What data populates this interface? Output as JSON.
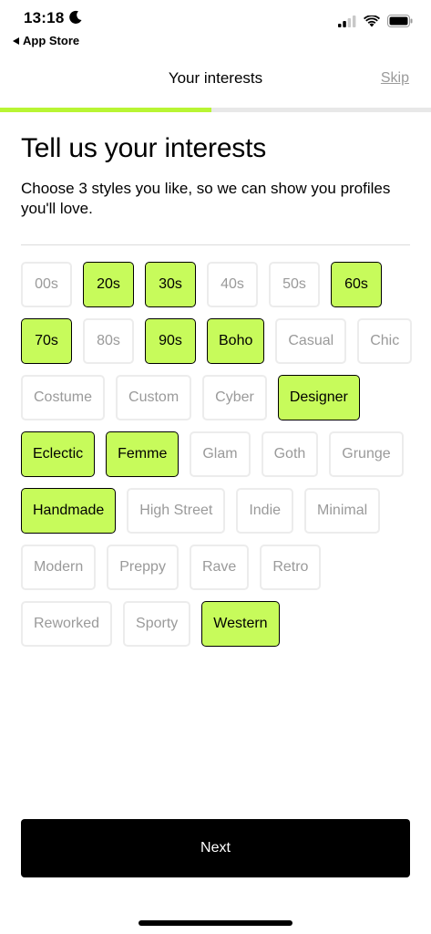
{
  "status_bar": {
    "time": "13:18",
    "back_app": "App Store",
    "icons": [
      "moon-icon",
      "cellular-signal-icon",
      "wifi-icon",
      "battery-icon"
    ]
  },
  "nav": {
    "title": "Your interests",
    "skip_label": "Skip"
  },
  "progress": {
    "fraction": 0.49
  },
  "content": {
    "heading": "Tell us your interests",
    "subheading": "Choose 3 styles you like, so we can show you profiles you'll love."
  },
  "interests": [
    {
      "label": "00s",
      "selected": false
    },
    {
      "label": "20s",
      "selected": true
    },
    {
      "label": "30s",
      "selected": true
    },
    {
      "label": "40s",
      "selected": false
    },
    {
      "label": "50s",
      "selected": false
    },
    {
      "label": "60s",
      "selected": true
    },
    {
      "label": "70s",
      "selected": true
    },
    {
      "label": "80s",
      "selected": false
    },
    {
      "label": "90s",
      "selected": true
    },
    {
      "label": "Boho",
      "selected": true
    },
    {
      "label": "Casual",
      "selected": false
    },
    {
      "label": "Chic",
      "selected": false
    },
    {
      "label": "Costume",
      "selected": false
    },
    {
      "label": "Custom",
      "selected": false
    },
    {
      "label": "Cyber",
      "selected": false
    },
    {
      "label": "Designer",
      "selected": true
    },
    {
      "label": "Eclectic",
      "selected": true
    },
    {
      "label": "Femme",
      "selected": true
    },
    {
      "label": "Glam",
      "selected": false
    },
    {
      "label": "Goth",
      "selected": false
    },
    {
      "label": "Grunge",
      "selected": false
    },
    {
      "label": "Handmade",
      "selected": true
    },
    {
      "label": "High Street",
      "selected": false
    },
    {
      "label": "Indie",
      "selected": false
    },
    {
      "label": "Minimal",
      "selected": false
    },
    {
      "label": "Modern",
      "selected": false
    },
    {
      "label": "Preppy",
      "selected": false
    },
    {
      "label": "Rave",
      "selected": false
    },
    {
      "label": "Retro",
      "selected": false
    },
    {
      "label": "Reworked",
      "selected": false
    },
    {
      "label": "Sporty",
      "selected": false
    },
    {
      "label": "Western",
      "selected": true
    }
  ],
  "footer": {
    "next_label": "Next"
  },
  "colors": {
    "accent": "#c7fb5b",
    "progress": "#b8f534",
    "button_bg": "#000000",
    "muted_text": "#9a9a9a",
    "chip_border": "#ececec"
  }
}
